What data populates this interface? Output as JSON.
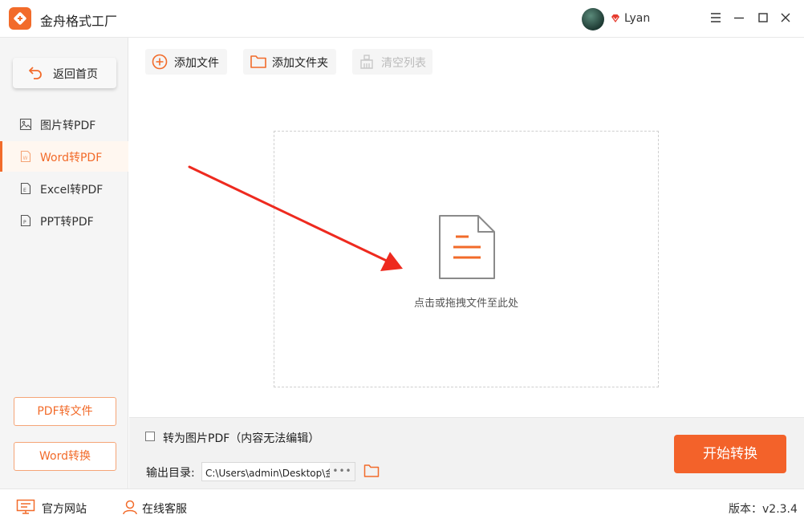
{
  "app": {
    "title": "金舟格式工厂"
  },
  "user": {
    "name": "Lyan"
  },
  "sidebar": {
    "home_label": "返回首页",
    "items": [
      {
        "label": "图片转PDF",
        "icon": "image-file-icon",
        "active": false
      },
      {
        "label": "Word转PDF",
        "icon": "word-file-icon",
        "active": true
      },
      {
        "label": "Excel转PDF",
        "icon": "excel-file-icon",
        "active": false
      },
      {
        "label": "PPT转PDF",
        "icon": "ppt-file-icon",
        "active": false
      }
    ],
    "bottom_buttons": [
      "PDF转文件",
      "Word转换"
    ]
  },
  "toolbar": {
    "add_file": "添加文件",
    "add_folder": "添加文件夹",
    "clear_list": "清空列表"
  },
  "dropzone": {
    "hint": "点击或拖拽文件至此处"
  },
  "options": {
    "to_image_pdf": "转为图片PDF（内容无法编辑）",
    "to_image_pdf_checked": false,
    "output_label": "输出目录:",
    "output_path": "C:\\Users\\admin\\Desktop\\金",
    "more": "•••",
    "start_button": "开始转换"
  },
  "status": {
    "website": "官方网站",
    "support": "在线客服",
    "version": "版本：v2.3.4"
  },
  "colors": {
    "accent": "#f26b2a",
    "start_button": "#f3622a",
    "arrow": "#ee2a1f"
  }
}
